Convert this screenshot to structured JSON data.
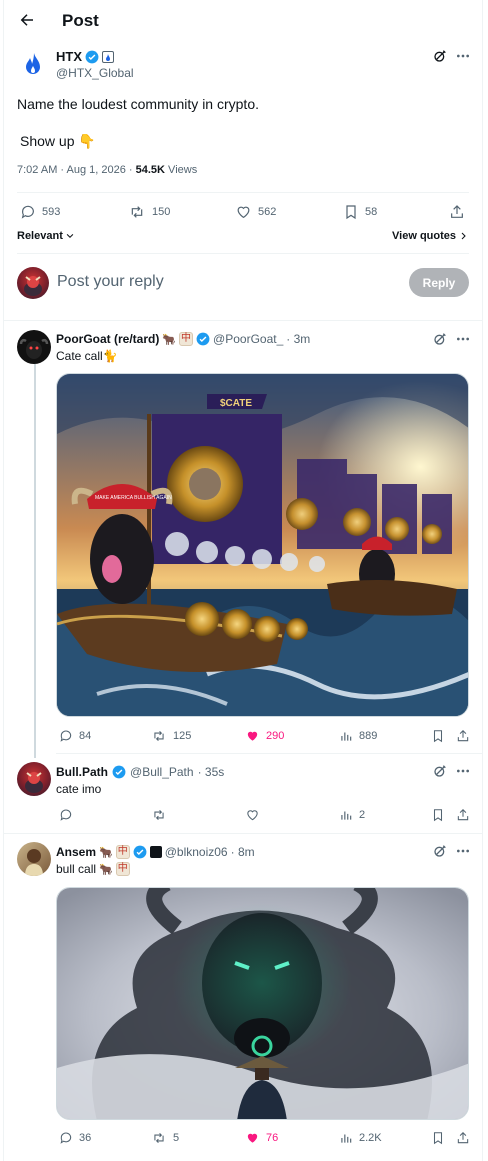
{
  "header": {
    "title": "Post"
  },
  "post": {
    "author_name": "HTX",
    "author_handle": "@HTX_Global",
    "text_line1": "Name the loudest community in crypto.",
    "text_line2": "Show up 👇",
    "time": "7:02 AM · Aug 1, 2026 · ",
    "views_count": "54.5K",
    "views_label": " Views",
    "stats": {
      "replies": "593",
      "reposts": "150",
      "likes": "562",
      "bookmarks": "58"
    },
    "relevant_label": "Relevant",
    "view_quotes_label": "View quotes"
  },
  "reply_box": {
    "placeholder": "Post your reply",
    "button": "Reply"
  },
  "replies": [
    {
      "name": "PoorGoat (re/tard)",
      "handle": "@PoorGoat_",
      "time": " · 3m",
      "text": "Cate call🐈",
      "stats": {
        "replies": "84",
        "reposts": "125",
        "likes": "290",
        "views": "889"
      },
      "liked": true
    },
    {
      "name": "Bull.Path",
      "handle": "@Bull_Path",
      "time": " · 35s",
      "text": "cate imo",
      "stats": {
        "replies": "",
        "reposts": "",
        "likes": "",
        "views": "2"
      },
      "liked": false
    },
    {
      "name": "Ansem",
      "handle": "@blknoiz06",
      "time": " · 8m",
      "text": "bull call",
      "stats": {
        "replies": "36",
        "reposts": "5",
        "likes": "76",
        "views": "2.2K"
      },
      "liked": true
    }
  ],
  "image_text": {
    "flag": "$CATE",
    "hat": "MAKE AMERICA BULLISH AGAIN"
  },
  "colors": {
    "accent": "#1d9bf0",
    "like": "#f91880",
    "muted": "#536471",
    "gold": "#e2b719"
  }
}
